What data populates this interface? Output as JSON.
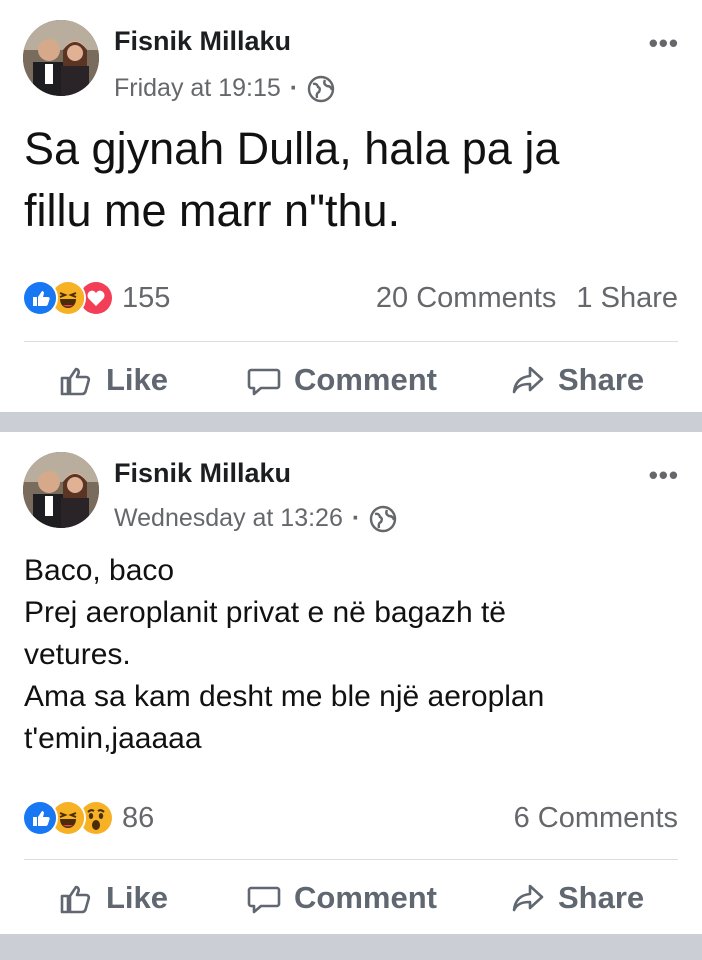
{
  "posts": [
    {
      "author": "Fisnik Millaku",
      "time": "Friday at 19:15",
      "separator": "·",
      "privacy_icon": "globe-icon",
      "text_lines": [
        "Sa gjynah Dulla, hala pa ja",
        "fillu me marr n\"thu."
      ],
      "reactions": [
        "like",
        "haha",
        "love"
      ],
      "reaction_count": "155",
      "comments": "20 Comments",
      "shares": "1 Share",
      "actions": {
        "like": "Like",
        "comment": "Comment",
        "share": "Share"
      }
    },
    {
      "author": "Fisnik Millaku",
      "time": "Wednesday at 13:26",
      "separator": "·",
      "privacy_icon": "globe-icon",
      "text_lines": [
        "Baco, baco",
        "Prej aeroplanit privat e në bagazh të",
        "vetures.",
        "Ama sa kam desht me ble një aeroplan",
        "t'emin,jaaaaa"
      ],
      "reactions": [
        "like",
        "haha",
        "wow"
      ],
      "reaction_count": "86",
      "comments": "6 Comments",
      "actions": {
        "like": "Like",
        "comment": "Comment",
        "share": "Share"
      }
    }
  ],
  "more_label": "•••",
  "colors": {
    "like": "#1877f2",
    "love": "#f33e58",
    "haha": "#f7b125",
    "text_secondary": "#65676b",
    "separator": "#cbcfd5"
  }
}
